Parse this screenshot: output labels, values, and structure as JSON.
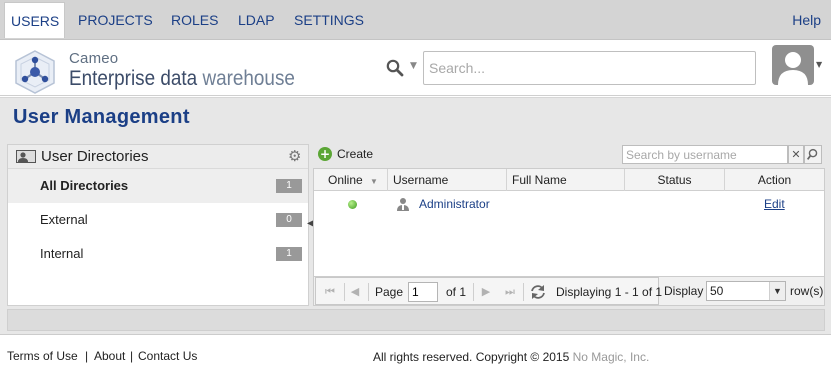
{
  "nav": {
    "tabs": [
      {
        "label": "USERS"
      },
      {
        "label": "PROJECTS"
      },
      {
        "label": "ROLES"
      },
      {
        "label": "LDAP"
      },
      {
        "label": "SETTINGS"
      }
    ],
    "active_tab": "USERS",
    "help_label": "Help"
  },
  "header": {
    "brand_top": "Cameo",
    "brand_main": "Enterprise data ",
    "brand_tail": "warehouse",
    "search_placeholder": "Search...",
    "search_icon": "magnifier-icon",
    "avatar_icon": "user-silhouette-icon"
  },
  "page": {
    "title": "User Management"
  },
  "directories": {
    "title": "User Directories",
    "items": [
      {
        "label": "All Directories",
        "count": "1",
        "active": true
      },
      {
        "label": "External",
        "count": "0",
        "active": false
      },
      {
        "label": "Internal",
        "count": "1",
        "active": false
      }
    ]
  },
  "toolbar": {
    "create_label": "Create",
    "username_search_placeholder": "Search by username",
    "clear_symbol": "✕"
  },
  "grid": {
    "columns": [
      "Online",
      "Username",
      "Full Name",
      "Status",
      "Action"
    ],
    "rows": [
      {
        "online": true,
        "username": "Administrator",
        "full_name": "",
        "status": "",
        "action": "Edit"
      }
    ]
  },
  "pager": {
    "page_label": "Page",
    "page_value": "1",
    "of_label": "of 1",
    "displaying": "Displaying 1 - 1 of 1",
    "display_label": "Display",
    "display_value": "50",
    "rows_suffix": "row(s)"
  },
  "footer": {
    "links": [
      "Terms of Use",
      "About",
      "Contact Us"
    ],
    "copyright": "All rights reserved. Copyright © 2015 ",
    "company": "No Magic, Inc."
  },
  "colors": {
    "accent": "#1b3f86",
    "online": "#3d9a1e",
    "create": "#5ba635"
  }
}
